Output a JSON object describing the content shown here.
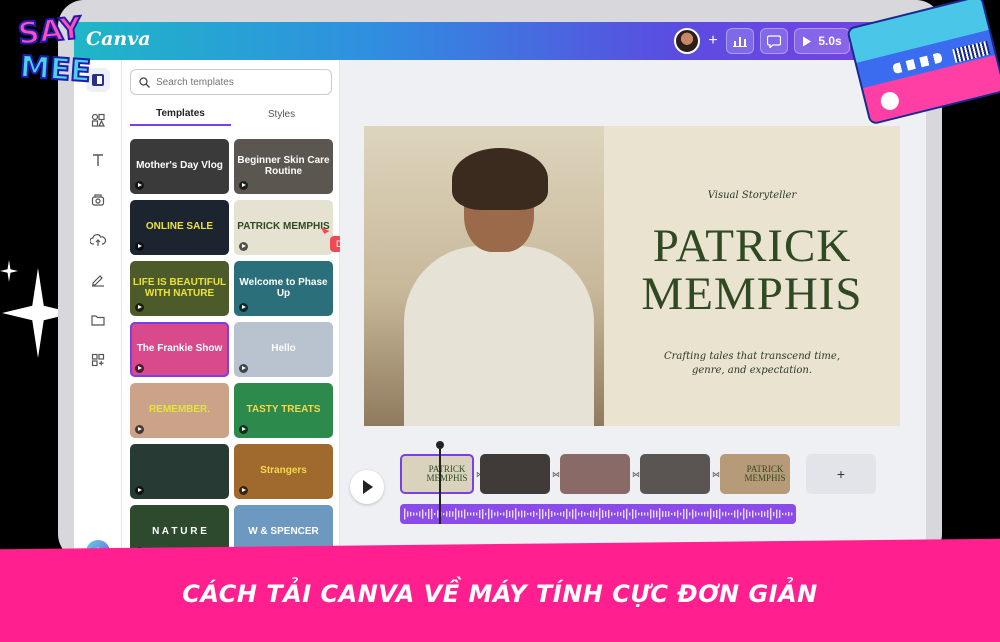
{
  "logo": {
    "line1": "SAY",
    "line2": "MEE"
  },
  "app": {
    "brand": "Canva"
  },
  "topbar": {
    "plus": "+",
    "chart_icon": "bar-chart-icon",
    "comment_icon": "comment-icon",
    "duration": "5.0s",
    "share_icon": "share-icon"
  },
  "panel": {
    "search_placeholder": "Search templates",
    "tabs": [
      {
        "label": "Templates"
      },
      {
        "label": "Styles"
      }
    ],
    "thumbnails": [
      {
        "text": "Mother's Day Vlog",
        "bg": "#3a3a3a"
      },
      {
        "text": "Beginner Skin Care Routine",
        "bg": "#5b5650"
      },
      {
        "text": "ONLINE SALE",
        "bg": "#1c2430",
        "color": "#e8e23a"
      },
      {
        "text": "PATRICK MEMPHIS",
        "bg": "#e6e2d1",
        "color": "#2f4a22"
      },
      {
        "text": "LIFE IS BEAUTIFUL WITH NATURE",
        "bg": "#4d5a2a",
        "color": "#e8e23a"
      },
      {
        "text": "Welcome to Phase Up",
        "bg": "#2a6f79"
      },
      {
        "text": "The Frankie Show",
        "bg": "#d94a8c",
        "selected": true
      },
      {
        "text": "Hello",
        "bg": "#b9c3cf"
      },
      {
        "text": "REMEMBER.",
        "bg": "#caa389",
        "color": "#e8e23a"
      },
      {
        "text": "TASTY TREATS",
        "bg": "#2c8a4d",
        "color": "#f6d84a"
      },
      {
        "text": "",
        "bg": "#273a34"
      },
      {
        "text": "Strangers",
        "bg": "#a06a2f",
        "color": "#f6d84a"
      },
      {
        "text": "N A T U R E",
        "bg": "#2d4a2f"
      },
      {
        "text": "W & SPENCER",
        "bg": "#6d98bf"
      }
    ]
  },
  "cursor": {
    "label": "Dianne"
  },
  "slide": {
    "kicker": "Visual Storyteller",
    "title_line1": "PATRICK",
    "title_line2": "MEMPHIS",
    "subtitle_line1": "Crafting tales that transcend time,",
    "subtitle_line2": "genre, and expectation."
  },
  "timeline": {
    "clips": [
      {
        "text": "PATRICK MEMPHIS",
        "bg": "#d9d3bd",
        "selected": true
      },
      {
        "text": "",
        "bg": "#403a38"
      },
      {
        "text": "",
        "bg": "#8a6a66"
      },
      {
        "text": "",
        "bg": "#5a5553"
      },
      {
        "text": "PATRICK MEMPHIS",
        "bg": "#b79a77"
      }
    ],
    "add_label": "+"
  },
  "banner": {
    "text": "CÁCH TẢI CANVA VỀ MÁY TÍNH CỰC ĐƠN GIẢN"
  }
}
